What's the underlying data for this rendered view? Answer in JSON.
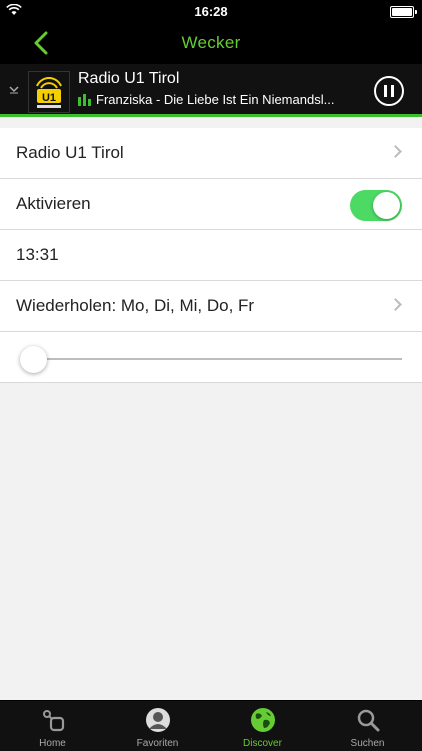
{
  "status": {
    "time": "16:28"
  },
  "nav": {
    "title": "Wecker"
  },
  "player": {
    "station": "Radio U1 Tirol",
    "track": "Franziska - Die Liebe Ist Ein Niemandsl..."
  },
  "settings": {
    "station_label": "Radio U1 Tirol",
    "activate_label": "Aktivieren",
    "activate_on": true,
    "time": "13:31",
    "repeat_label": "Wiederholen: Mo, Di, Mi, Do, Fr",
    "volume_level": 0
  },
  "tabs": [
    {
      "label": "Home",
      "icon": "home-icon"
    },
    {
      "label": "Favoriten",
      "icon": "favorites-icon"
    },
    {
      "label": "Discover",
      "icon": "globe-icon",
      "active": true
    },
    {
      "label": "Suchen",
      "icon": "search-icon"
    }
  ],
  "colors": {
    "accent": "#66cc33",
    "toggle": "#4cd964",
    "player_border": "#3bbf2b"
  }
}
